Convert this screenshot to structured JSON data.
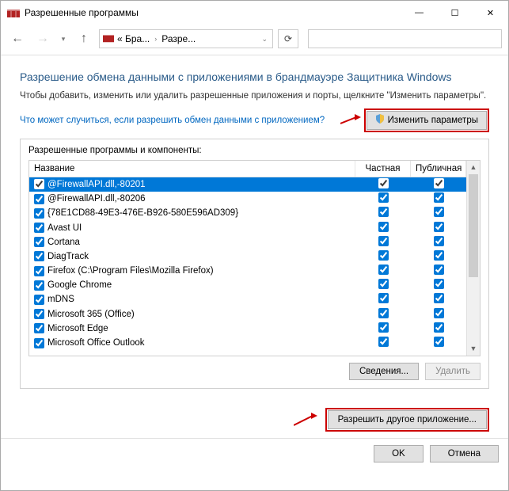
{
  "window": {
    "title": "Разрешенные программы"
  },
  "breadcrumb": {
    "c1": "« Бра...",
    "c2": "Разре..."
  },
  "page": {
    "heading": "Разрешение обмена данными с приложениями в брандмауэре Защитника Windows",
    "subtext": "Чтобы добавить, изменить или удалить разрешенные приложения и порты, щелкните \"Изменить параметры\".",
    "link": "Что может случиться, если разрешить обмен данными с приложением?",
    "change_settings": "Изменить параметры"
  },
  "group": {
    "label": "Разрешенные программы и компоненты:",
    "col_name": "Название",
    "col_private": "Частная",
    "col_public": "Публичная",
    "rows": [
      {
        "enabled": true,
        "name": "@FirewallAPI.dll,-80201",
        "priv": true,
        "pub": true,
        "selected": true
      },
      {
        "enabled": true,
        "name": "@FirewallAPI.dll,-80206",
        "priv": true,
        "pub": true
      },
      {
        "enabled": true,
        "name": "{78E1CD88-49E3-476E-B926-580E596AD309}",
        "priv": true,
        "pub": true
      },
      {
        "enabled": true,
        "name": "Avast UI",
        "priv": true,
        "pub": true
      },
      {
        "enabled": true,
        "name": "Cortana",
        "priv": true,
        "pub": true
      },
      {
        "enabled": true,
        "name": "DiagTrack",
        "priv": true,
        "pub": true
      },
      {
        "enabled": true,
        "name": "Firefox (C:\\Program Files\\Mozilla Firefox)",
        "priv": true,
        "pub": true
      },
      {
        "enabled": true,
        "name": "Google Chrome",
        "priv": true,
        "pub": true
      },
      {
        "enabled": true,
        "name": "mDNS",
        "priv": true,
        "pub": true
      },
      {
        "enabled": true,
        "name": "Microsoft 365 (Office)",
        "priv": true,
        "pub": true
      },
      {
        "enabled": true,
        "name": "Microsoft Edge",
        "priv": true,
        "pub": true
      },
      {
        "enabled": true,
        "name": "Microsoft Office Outlook",
        "priv": true,
        "pub": true
      }
    ],
    "details_btn": "Сведения...",
    "remove_btn": "Удалить"
  },
  "allow_other_btn": "Разрешить другое приложение...",
  "footer": {
    "ok": "OK",
    "cancel": "Отмена"
  }
}
